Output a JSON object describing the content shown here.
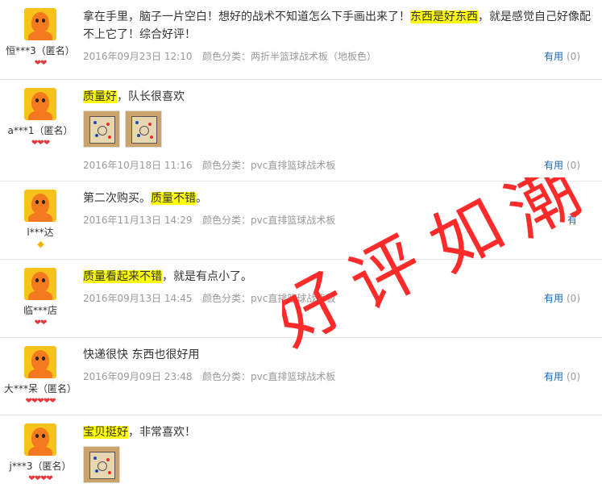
{
  "reviews": [
    {
      "user": "恒***3（匿名）",
      "badge_count": 2,
      "badge_type": "red",
      "text_parts": [
        {
          "t": "拿在手里，脑子一片空白！想好的战术不知道怎么下手画出来了！",
          "hl": false
        },
        {
          "t": "东西是好东西",
          "hl": true
        },
        {
          "t": "，就是感觉自己好像配不上它了！综合好评！",
          "hl": false
        }
      ],
      "date": "2016年09月23日 12:10",
      "category": "颜色分类：两折半篮球战术板（地板色）",
      "useful_label": "有用",
      "useful_count": "(0)"
    },
    {
      "user": "a***1（匿名）",
      "badge_count": 3,
      "badge_type": "red",
      "text_parts": [
        {
          "t": "质量好",
          "hl": true
        },
        {
          "t": "，队长很喜欢",
          "hl": false
        }
      ],
      "images": 2,
      "date": "2016年10月18日 11:16",
      "category": "颜色分类：pvc直排篮球战术板",
      "useful_label": "有用",
      "useful_count": "(0)"
    },
    {
      "user": "l***达",
      "badge_count": 1,
      "badge_type": "yellow",
      "text_parts": [
        {
          "t": "第二次购买。",
          "hl": false
        },
        {
          "t": "质量不错",
          "hl": true
        },
        {
          "t": "。",
          "hl": false
        }
      ],
      "date": "2016年11月13日 14:29",
      "category": "颜色分类：pvc直排篮球战术板",
      "useful_label": "有",
      "useful_count": ""
    },
    {
      "user": "临***店",
      "badge_count": 2,
      "badge_type": "red",
      "text_parts": [
        {
          "t": "质量看起来不错",
          "hl": true
        },
        {
          "t": "，就是有点小了。",
          "hl": false
        }
      ],
      "date": "2016年09月13日 14:45",
      "category": "颜色分类：pvc直排篮球战术板",
      "useful_label": "有用",
      "useful_count": "(0)"
    },
    {
      "user": "大***呆（匿名）",
      "badge_count": 5,
      "badge_type": "red",
      "text_parts": [
        {
          "t": "快递很快 东西也很好用",
          "hl": false
        }
      ],
      "date": "2016年09月09日 23:48",
      "category": "颜色分类：pvc直排篮球战术板",
      "useful_label": "有用",
      "useful_count": "(0)"
    },
    {
      "user": "j***3（匿名）",
      "badge_count": 4,
      "badge_type": "red",
      "text_parts": [
        {
          "t": "宝贝挺好",
          "hl": true
        },
        {
          "t": "，非常喜欢！",
          "hl": false
        }
      ],
      "images": 1,
      "date": "",
      "category": "",
      "useful_label": "",
      "useful_count": ""
    }
  ],
  "watermark": [
    "好",
    "评",
    "如",
    "潮"
  ],
  "colors": {
    "highlight": "#ffff00",
    "link": "#1a66b3",
    "watermark": "#ff2a2a"
  }
}
